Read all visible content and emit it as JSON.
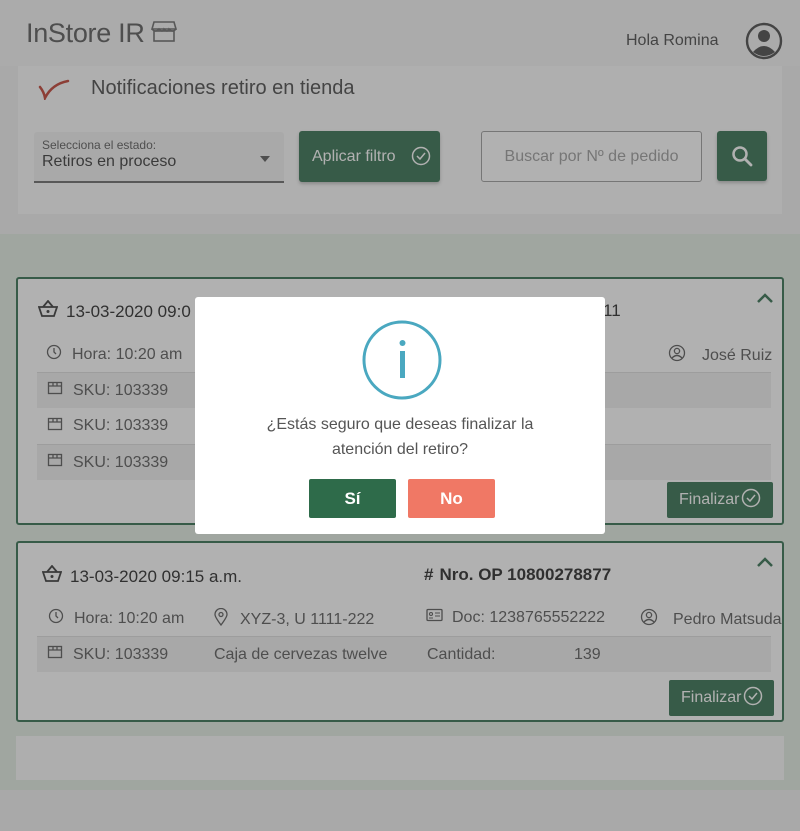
{
  "app": {
    "logo_text": "InStore IR",
    "greeting": "Hola Romina"
  },
  "filter": {
    "title": "Notificaciones retiro en tienda",
    "select_label": "Selecciona el estado:",
    "select_value": "Retiros en proceso",
    "apply_label": "Aplicar filtro",
    "search_placeholder": "Buscar por Nº de pedido"
  },
  "cards": [
    {
      "date": "13-03-2020 09:0",
      "order_fragment": "11",
      "time": "Hora: 10:20 am",
      "person": "José Ruiz",
      "skus": [
        "SKU: 103339",
        "SKU: 103339",
        "SKU: 103339"
      ],
      "finalize_label": "Finalizar"
    },
    {
      "date": "13-03-2020 09:15 a.m.",
      "order": "Nro. OP 10800278877",
      "time": "Hora: 10:20 am",
      "location": "XYZ-3, U 1111-222",
      "doc": "Doc: 1238765552222",
      "person": "Pedro Matsuda",
      "sku": "SKU: 103339",
      "product": "Caja de cervezas twelve",
      "qty_label": "Cantidad:",
      "qty_value": "139",
      "finalize_label": "Finalizar"
    }
  ],
  "modal": {
    "message_line1": "¿Estás seguro que deseas finalizar la",
    "message_line2": "atención del retiro?",
    "yes_label": "Sí",
    "no_label": "No"
  },
  "colors": {
    "primary": "#2e6b4a",
    "danger": "#f07865",
    "info": "#4aa8c0",
    "brand_mark": "#c0392b"
  }
}
